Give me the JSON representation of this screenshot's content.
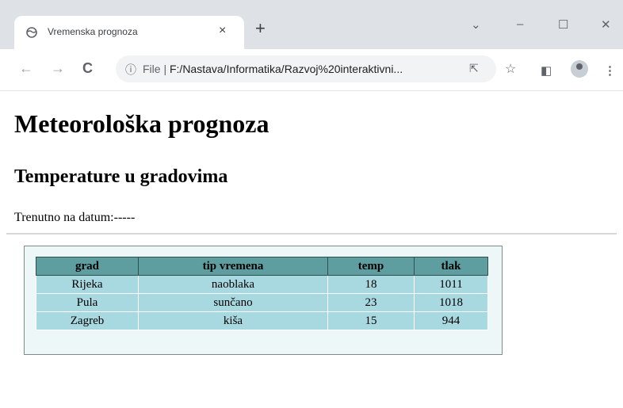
{
  "browser": {
    "tab_title": "Vremenska prognoza",
    "tab_close": "×",
    "new_tab": "+",
    "favicon": "globe-icon",
    "controls": {
      "dropdown": "⌄",
      "minimize": "–",
      "maximize": "☐",
      "close": "✕"
    },
    "nav": {
      "back": "←",
      "forward": "→",
      "reload": "C"
    },
    "address": {
      "info": "ⓘ",
      "scheme": "File",
      "separator": "|",
      "path": "F:/Nastava/Informatika/Razvoj%20interaktivni..."
    },
    "toolbar_icons": {
      "share": "⇱",
      "bookmark": "☆",
      "sidepanel": "◧",
      "menu": "⋮"
    }
  },
  "page": {
    "title": "Meteorološka prognoza",
    "subtitle": "Temperature u gradovima",
    "status": "Trenutno na datum:-----",
    "table": {
      "headers": [
        "grad",
        "tip vremena",
        "temp",
        "tlak"
      ],
      "rows": [
        [
          "Rijeka",
          "naoblaka",
          "18",
          "1011"
        ],
        [
          "Pula",
          "sunčano",
          "23",
          "1018"
        ],
        [
          "Zagreb",
          "kiša",
          "15",
          "944"
        ]
      ]
    }
  }
}
